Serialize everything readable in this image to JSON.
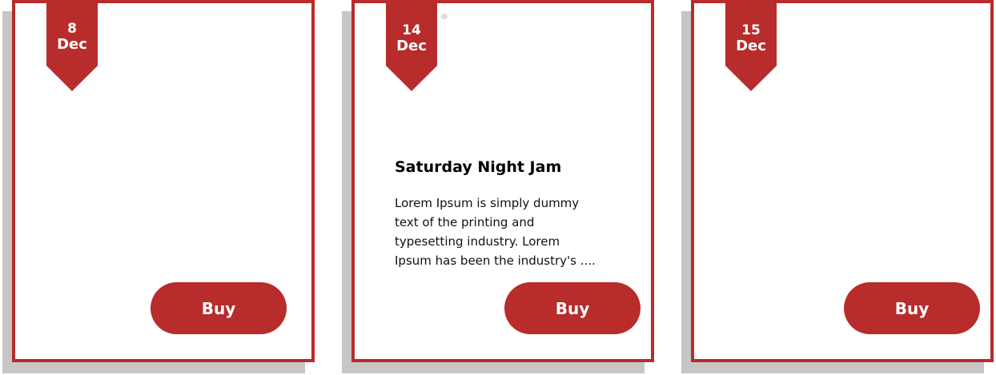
{
  "cards": [
    {
      "day": "8",
      "month": "Dec",
      "title": "",
      "description": "",
      "button_label": "Buy"
    },
    {
      "day": "14",
      "month": "Dec",
      "title": "Saturday Night Jam",
      "description": "Lorem Ipsum is simply dummy text of the printing and typesetting industry. Lorem Ipsum has been the industry's ....",
      "button_label": "Buy"
    },
    {
      "day": "15",
      "month": "Dec",
      "title": "",
      "description": "",
      "button_label": "Buy"
    }
  ],
  "colors": {
    "accent": "#b82c2c",
    "shadow": "#c6c6c6"
  }
}
